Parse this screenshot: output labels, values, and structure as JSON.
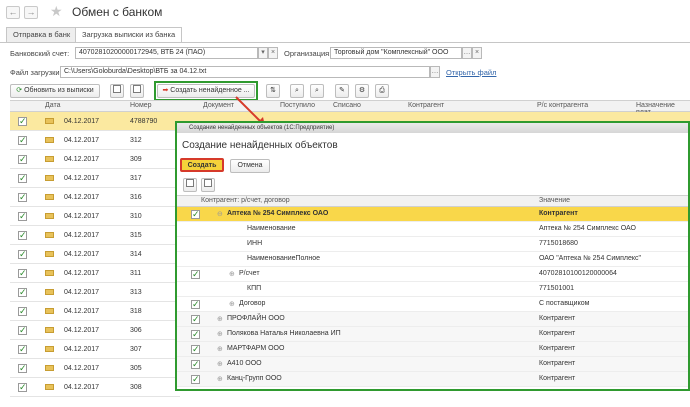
{
  "window": {
    "title": "Обмен с банком"
  },
  "tabs": [
    {
      "label": "Отправка в банк"
    },
    {
      "label": "Загрузка выписки из банка"
    }
  ],
  "form": {
    "bank_account_label": "Банковский счет:",
    "bank_account_value": "40702810200000172945, ВТБ 24 (ПАО)",
    "org_label": "Организация:",
    "org_value": "Торговый дом \"Комплексный\" ООО",
    "file_label": "Файл загрузки:",
    "file_value": "C:\\Users\\Goloburda\\Desktop\\ВТБ за 04.12.txt",
    "open_file_link": "Открыть файл"
  },
  "toolbar": {
    "refresh_label": "Обновить из выписки",
    "create_missing_label": "Создать ненайденное ..."
  },
  "table": {
    "columns": [
      "Дата",
      "Номер",
      "Документ",
      "Поступило",
      "Списано",
      "Контрагент",
      "Р/с контрагента",
      "Назначение плат"
    ],
    "rows": [
      {
        "date": "04.12.2017",
        "number": "4788790",
        "selected": true
      },
      {
        "date": "04.12.2017",
        "number": "312"
      },
      {
        "date": "04.12.2017",
        "number": "309"
      },
      {
        "date": "04.12.2017",
        "number": "317"
      },
      {
        "date": "04.12.2017",
        "number": "316"
      },
      {
        "date": "04.12.2017",
        "number": "310"
      },
      {
        "date": "04.12.2017",
        "number": "315"
      },
      {
        "date": "04.12.2017",
        "number": "314"
      },
      {
        "date": "04.12.2017",
        "number": "311"
      },
      {
        "date": "04.12.2017",
        "number": "313"
      },
      {
        "date": "04.12.2017",
        "number": "318"
      },
      {
        "date": "04.12.2017",
        "number": "306"
      },
      {
        "date": "04.12.2017",
        "number": "307"
      },
      {
        "date": "04.12.2017",
        "number": "305"
      },
      {
        "date": "04.12.2017",
        "number": "308"
      }
    ]
  },
  "dialog": {
    "window_title": "Создание ненайденных объектов (1С:Предприятие)",
    "heading": "Создание ненайденных объектов",
    "create_label": "Создать",
    "cancel_label": "Отмена",
    "col_counterparty": "Контрагент: р/счет, договор",
    "col_value": "Значение",
    "rows": [
      {
        "text": "Аптека № 254 Симплекс ОАО",
        "value": "Контрагент",
        "level": 1,
        "checkbox": true,
        "pm": "⊖",
        "selected": true
      },
      {
        "text": "Наименование",
        "value": "Аптека № 254 Симплекс ОАО",
        "level": 3
      },
      {
        "text": "ИНН",
        "value": "7715018680",
        "level": 3
      },
      {
        "text": "НаименованиеПолное",
        "value": "ОАО \"Аптека № 254 Симплекс\"",
        "level": 3
      },
      {
        "text": "Р/счет",
        "value": "40702810100120000064",
        "level": 2,
        "checkbox": true,
        "pm": "⊕"
      },
      {
        "text": "КПП",
        "value": "771501001",
        "level": 3
      },
      {
        "text": "Договор",
        "value": "С поставщиком",
        "level": 2,
        "checkbox": true,
        "pm": "⊕"
      },
      {
        "text": "ПРОФЛАЙН ООО",
        "value": "Контрагент",
        "level": 1,
        "checkbox": true,
        "pm": "⊕",
        "group": true
      },
      {
        "text": "Полякова Наталья Николаевна ИП",
        "value": "Контрагент",
        "level": 1,
        "checkbox": true,
        "pm": "⊕",
        "group": true
      },
      {
        "text": "МАРТФАРМ ООО",
        "value": "Контрагент",
        "level": 1,
        "checkbox": true,
        "pm": "⊕",
        "group": true
      },
      {
        "text": "А410 ООО",
        "value": "Контрагент",
        "level": 1,
        "checkbox": true,
        "pm": "⊕",
        "group": true
      },
      {
        "text": "Канц-Групп ООО",
        "value": "Контрагент",
        "level": 1,
        "checkbox": true,
        "pm": "⊕",
        "group": true
      }
    ]
  },
  "colors": {
    "highlight_green": "#2f9a2f",
    "arrow_red": "#d63a2a",
    "selection_yellow": "#f9d74a"
  }
}
